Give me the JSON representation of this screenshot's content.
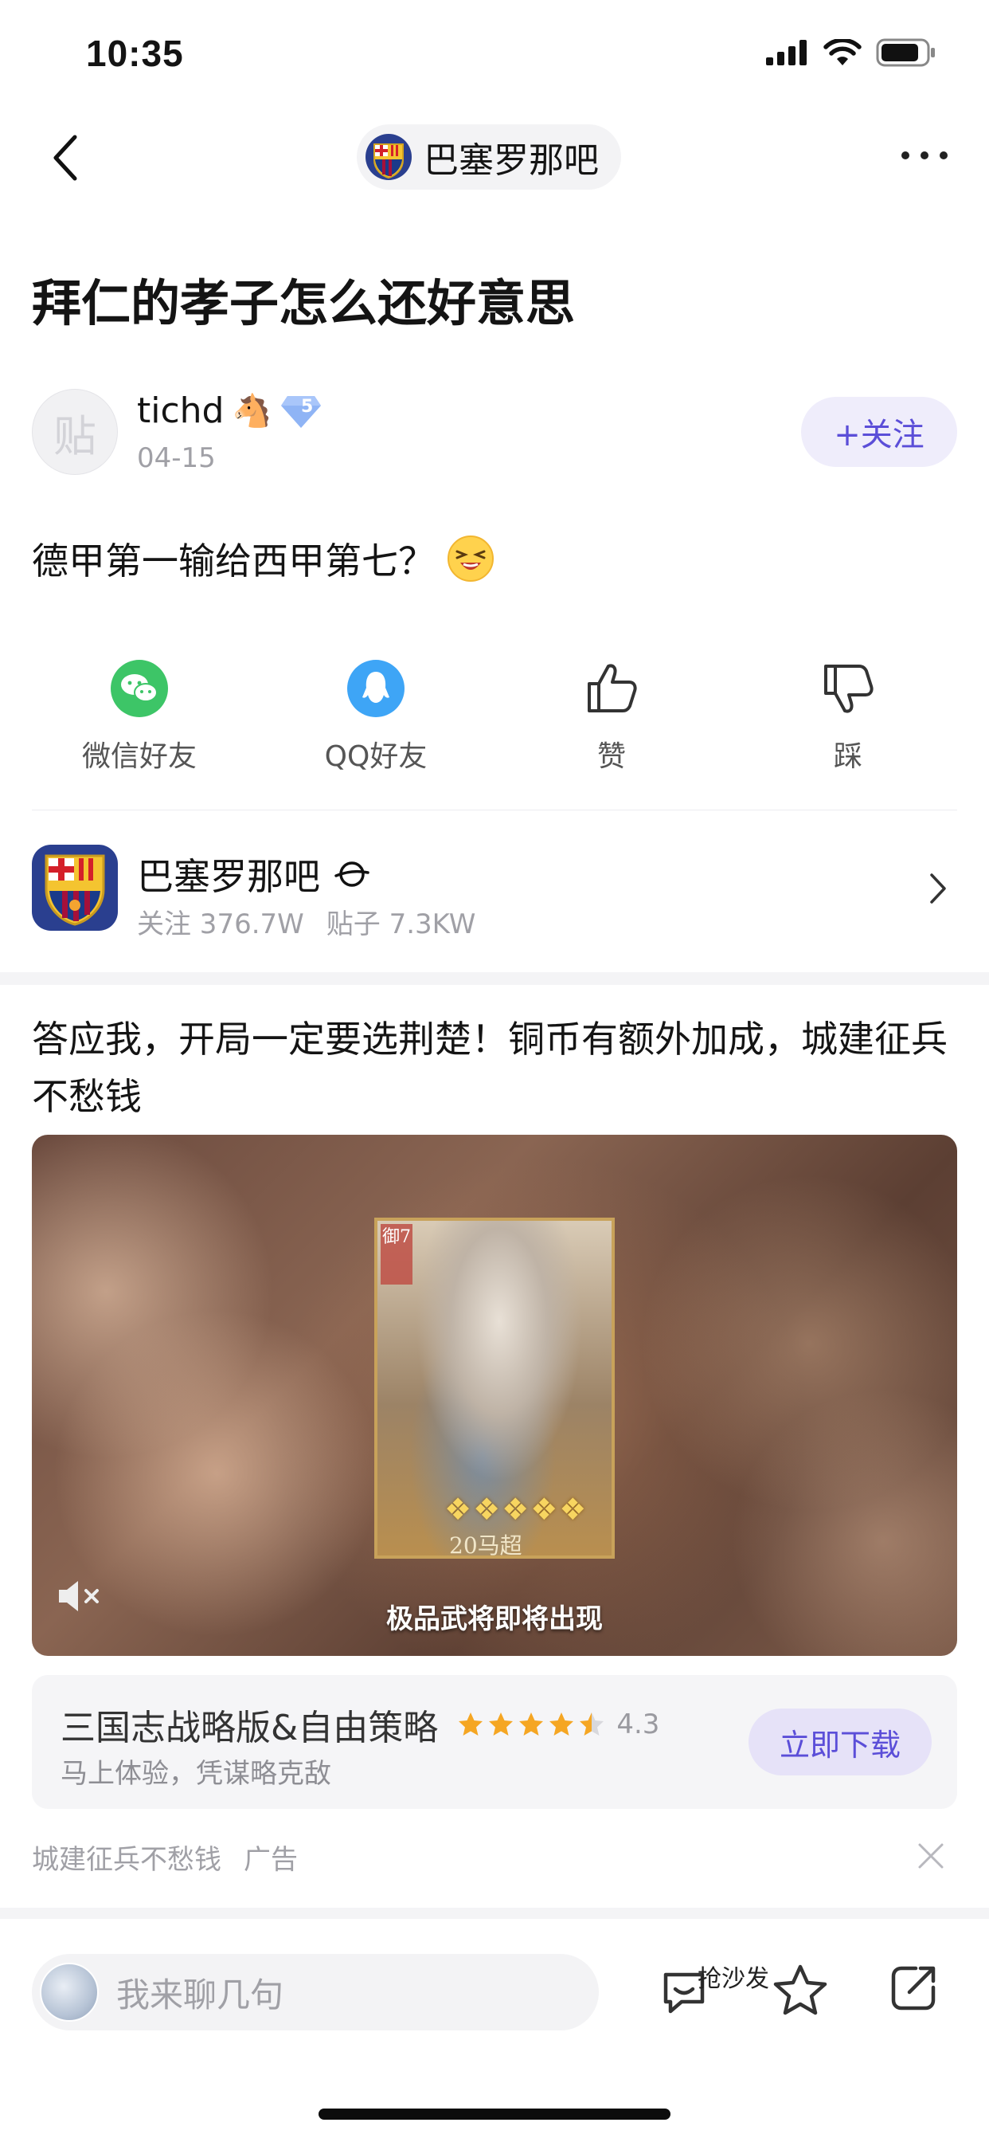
{
  "status_bar": {
    "time": "10:35"
  },
  "nav": {
    "forum_name": "巴塞罗那吧"
  },
  "post": {
    "title": "拜仁的孝子怎么还好意思",
    "author": {
      "name": "tichd",
      "level": "5",
      "date": "04-15",
      "avatar_char": "贴"
    },
    "follow_label": "+关注",
    "body": "德甲第一输给西甲第七？"
  },
  "share": {
    "items": [
      {
        "label": "微信好友",
        "icon": "wechat-icon"
      },
      {
        "label": "QQ好友",
        "icon": "qq-icon"
      },
      {
        "label": "赞",
        "icon": "thumbs-up-icon"
      },
      {
        "label": "踩",
        "icon": "thumbs-down-icon"
      }
    ]
  },
  "forum_card": {
    "name": "巴塞罗那吧",
    "followers": "关注 376.7W",
    "posts": "贴子 7.3KW"
  },
  "ad": {
    "text": "答应我，开局一定要选荆楚！铜币有额外加成，城建征兵不愁钱",
    "media_caption": "极品武将即将出现",
    "card_badge": "御7",
    "card_name": "20马超",
    "app_name": "三国志战略版&自由策略",
    "rating": "4.3",
    "app_subtitle": "马上体验，凭谋略克敌",
    "download_label": "立即下载",
    "footer_text": "城建征兵不愁钱",
    "ad_label": "广告"
  },
  "bottom_bar": {
    "input_placeholder": "我来聊几句",
    "sofa_label": "抢沙发"
  },
  "colors": {
    "accent": "#5b4ed8",
    "accent_bg": "#efedfb",
    "secondary_text": "#a0a0a6"
  }
}
